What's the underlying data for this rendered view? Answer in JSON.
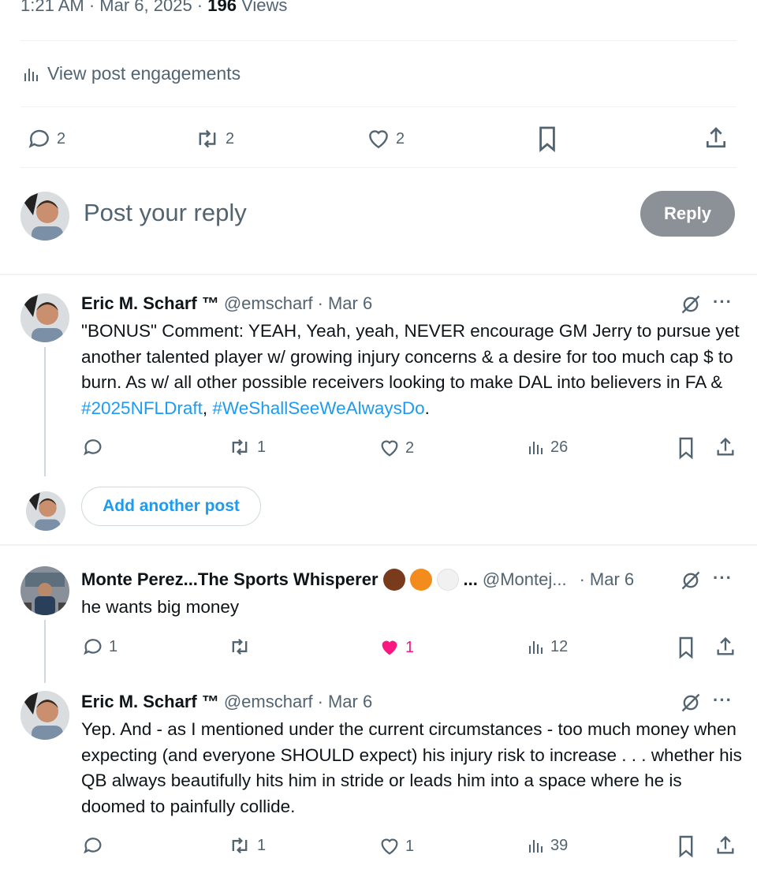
{
  "post_meta": {
    "time": "1:21 AM",
    "date": "Mar 6, 2025",
    "views_count": "196",
    "views_label": "Views"
  },
  "engagements": {
    "label": "View post engagements"
  },
  "main_actions": {
    "replies": "2",
    "reposts": "2",
    "likes": "2"
  },
  "composer": {
    "placeholder": "Post your reply",
    "reply_label": "Reply"
  },
  "thread": {
    "add_post_label": "Add another post",
    "tweets": [
      {
        "name": "Eric M. Scharf ™",
        "handle": "@emscharf",
        "sep": "·",
        "date": "Mar 6",
        "text_before": "\"BONUS\" Comment: YEAH, Yeah, yeah, NEVER encourage GM Jerry to pursue yet another talented player w/ growing injury concerns & a desire for too much cap $ to burn. As w/ all other possible receivers looking to make DAL into believers in FA & ",
        "hashtag1": "#2025NFLDraft",
        "comma": ", ",
        "hashtag2": "#WeShallSeeWeAlwaysDo",
        "period": ".",
        "replies": "",
        "reposts": "1",
        "likes": "2",
        "views": "26"
      },
      {
        "name": "Monte Perez...The Sports Whisperer",
        "ellipsis": "...",
        "handle": "@Montej...",
        "sep": "·",
        "date": "Mar 6",
        "text": "he wants big money",
        "replies": "1",
        "reposts": "",
        "likes": "1",
        "views": "12"
      },
      {
        "name": "Eric M. Scharf ™",
        "handle": "@emscharf",
        "sep": "·",
        "date": "Mar 6",
        "text": "Yep. And - as I mentioned under the current circumstances - too much money when expecting (and everyone SHOULD expect) his injury risk to increase . . . whether his QB always beautifully hits him in stride or leads him into a space where he is doomed to painfully collide.",
        "replies": "",
        "reposts": "1",
        "likes": "1",
        "views": "39"
      }
    ]
  },
  "colors": {
    "accent": "#1d9bf0",
    "like_active": "#f91880",
    "muted": "#536471",
    "reply_button": "#8b9196"
  },
  "icons": [
    "reply-icon",
    "repost-icon",
    "like-icon",
    "bookmark-icon",
    "share-icon",
    "views-icon",
    "grok-icon",
    "more-icon"
  ]
}
